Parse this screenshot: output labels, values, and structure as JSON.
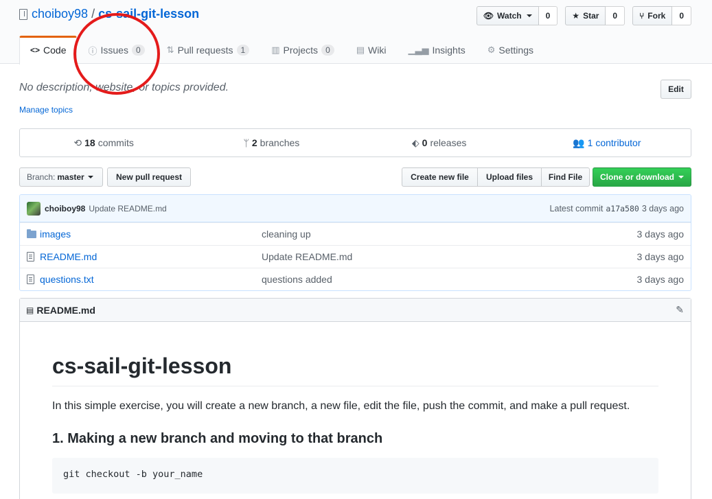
{
  "repo": {
    "owner": "choiboy98",
    "separator": "/",
    "name": "cs-sail-git-lesson"
  },
  "actions": {
    "watch_label": "Watch",
    "watch_count": "0",
    "star_label": "Star",
    "star_count": "0",
    "fork_label": "Fork",
    "fork_count": "0"
  },
  "nav": {
    "code": "Code",
    "issues": "Issues",
    "issues_count": "0",
    "pulls": "Pull requests",
    "pulls_count": "1",
    "projects": "Projects",
    "projects_count": "0",
    "wiki": "Wiki",
    "insights": "Insights",
    "settings": "Settings"
  },
  "description": {
    "text": "No description, website, or topics provided.",
    "manage_topics": "Manage topics",
    "edit": "Edit"
  },
  "numbers": {
    "commits_count": "18",
    "commits_label": "commits",
    "branches_count": "2",
    "branches_label": "branches",
    "releases_count": "0",
    "releases_label": "releases",
    "contributors": "1 contributor"
  },
  "filebar": {
    "branch_prefix": "Branch:",
    "branch_name": "master",
    "new_pr": "New pull request",
    "create_file": "Create new file",
    "upload_files": "Upload files",
    "find_file": "Find File",
    "clone": "Clone or download"
  },
  "commit": {
    "author": "choiboy98",
    "message": "Update README.md",
    "latest_label": "Latest commit",
    "sha": "a17a580",
    "age": "3 days ago"
  },
  "files": [
    {
      "type": "folder",
      "name": "images",
      "message": "cleaning up",
      "age": "3 days ago"
    },
    {
      "type": "file",
      "name": "README.md",
      "message": "Update README.md",
      "age": "3 days ago"
    },
    {
      "type": "file",
      "name": "questions.txt",
      "message": "questions added",
      "age": "3 days ago"
    }
  ],
  "readme": {
    "filename": "README.md",
    "h1": "cs-sail-git-lesson",
    "intro": "In this simple exercise, you will create a new branch, a new file, edit the file, push the commit, and make a pull request.",
    "h3": "1. Making a new branch and moving to that branch",
    "code": "git checkout -b your_name"
  },
  "colors": {
    "accent_tab": "#e36209",
    "link": "#0366d6",
    "clone_green": "#28a745",
    "annotation_red": "#e41b1b"
  }
}
